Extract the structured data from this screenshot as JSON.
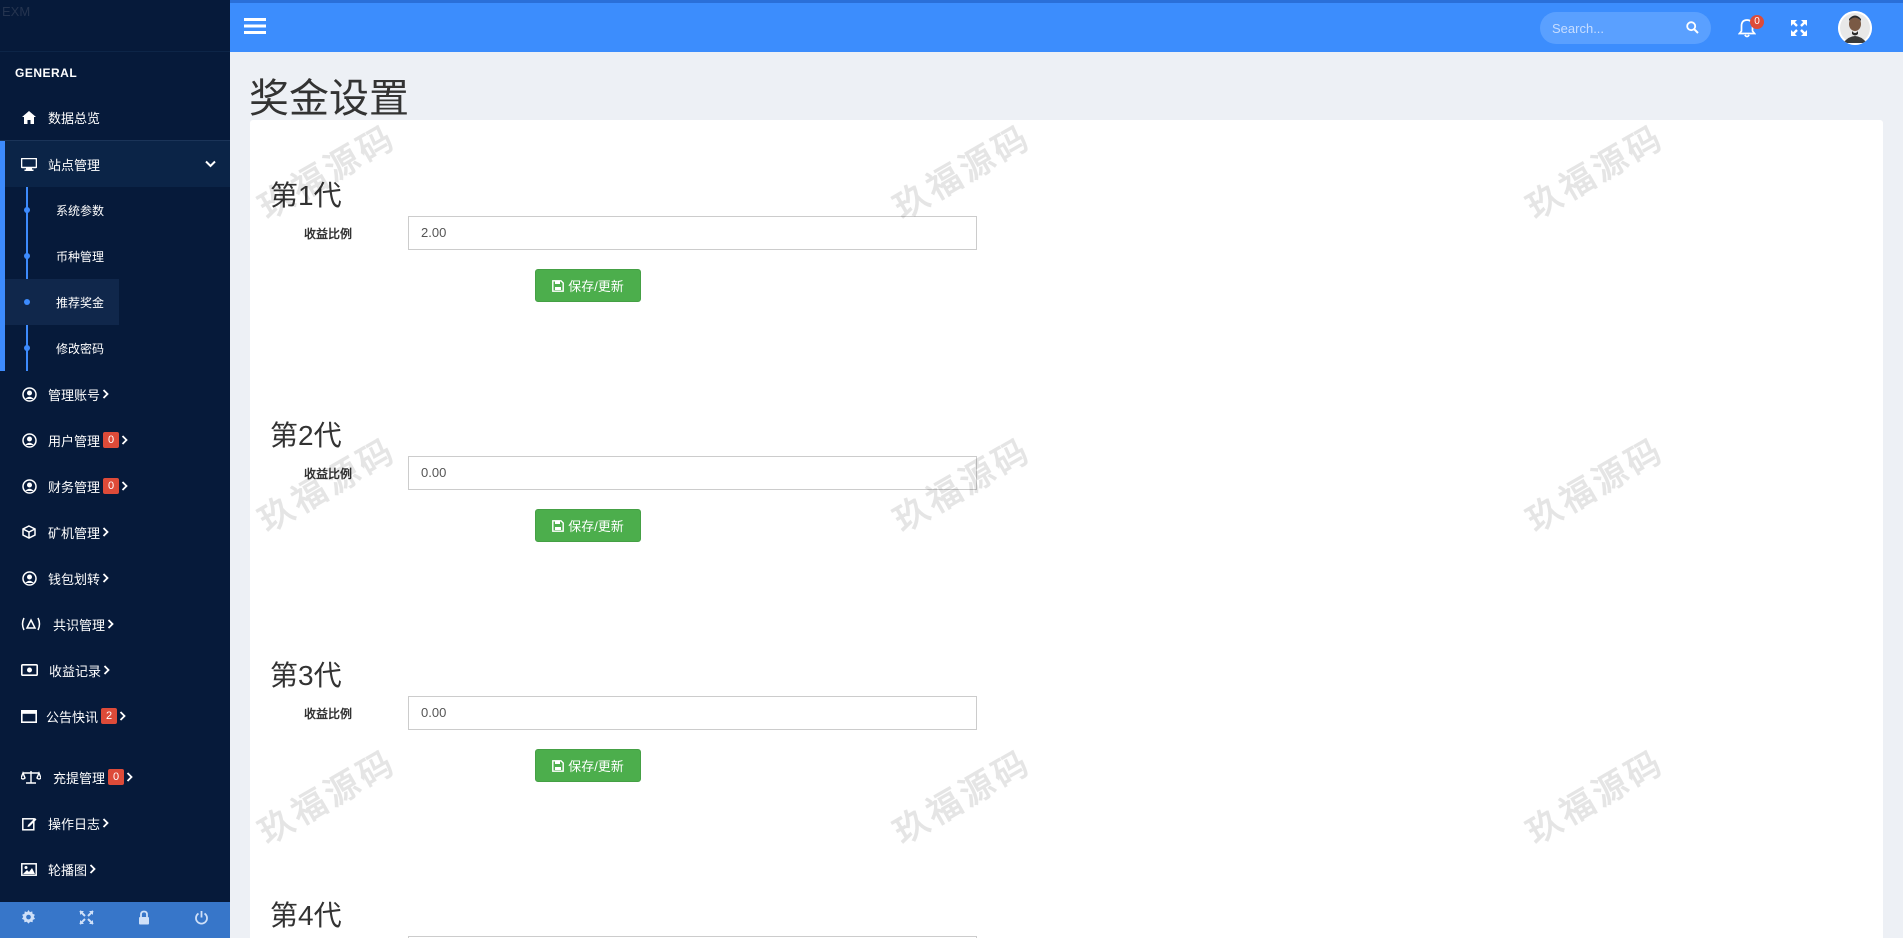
{
  "brand": {
    "text": "EXM"
  },
  "sidebar": {
    "section": "GENERAL",
    "items": [
      {
        "label": "数据总览",
        "icon": "home-icon"
      },
      {
        "label": "站点管理",
        "icon": "desktop-icon"
      },
      {
        "label": "管理账号",
        "icon": "user-circle-icon"
      },
      {
        "label": "用户管理",
        "icon": "user-circle-icon",
        "badge": "0"
      },
      {
        "label": "财务管理",
        "icon": "user-circle-icon",
        "badge": "0"
      },
      {
        "label": "矿机管理",
        "icon": "cube-icon"
      },
      {
        "label": "钱包划转",
        "icon": "user-circle-icon"
      },
      {
        "label": "共识管理",
        "icon": "consensus-icon"
      },
      {
        "label": "收益记录",
        "icon": "money-icon"
      },
      {
        "label": "公告快讯",
        "icon": "window-icon",
        "badge": "2"
      },
      {
        "label": "充提管理",
        "icon": "balance-scale-icon",
        "badge": "0"
      },
      {
        "label": "操作日志",
        "icon": "edit-icon"
      },
      {
        "label": "轮播图",
        "icon": "image-icon"
      }
    ],
    "sub_items": [
      {
        "label": "系统参数"
      },
      {
        "label": "币种管理"
      },
      {
        "label": "推荐奖金"
      },
      {
        "label": "修改密码"
      }
    ]
  },
  "header": {
    "search_placeholder": "Search...",
    "notification_count": "0"
  },
  "page": {
    "title": "奖金设置"
  },
  "generations": [
    {
      "title": "第1代",
      "label": "收益比例",
      "value": "2.00",
      "button": "保存/更新"
    },
    {
      "title": "第2代",
      "label": "收益比例",
      "value": "0.00",
      "button": "保存/更新"
    },
    {
      "title": "第3代",
      "label": "收益比例",
      "value": "0.00",
      "button": "保存/更新"
    },
    {
      "title": "第4代"
    }
  ],
  "watermark": "玖福源码",
  "colors": {
    "sidebar_bg": "#061a3a",
    "header_bg": "#3c8dfd",
    "save_button": "#4cae4c",
    "badge": "#dd4b39"
  }
}
